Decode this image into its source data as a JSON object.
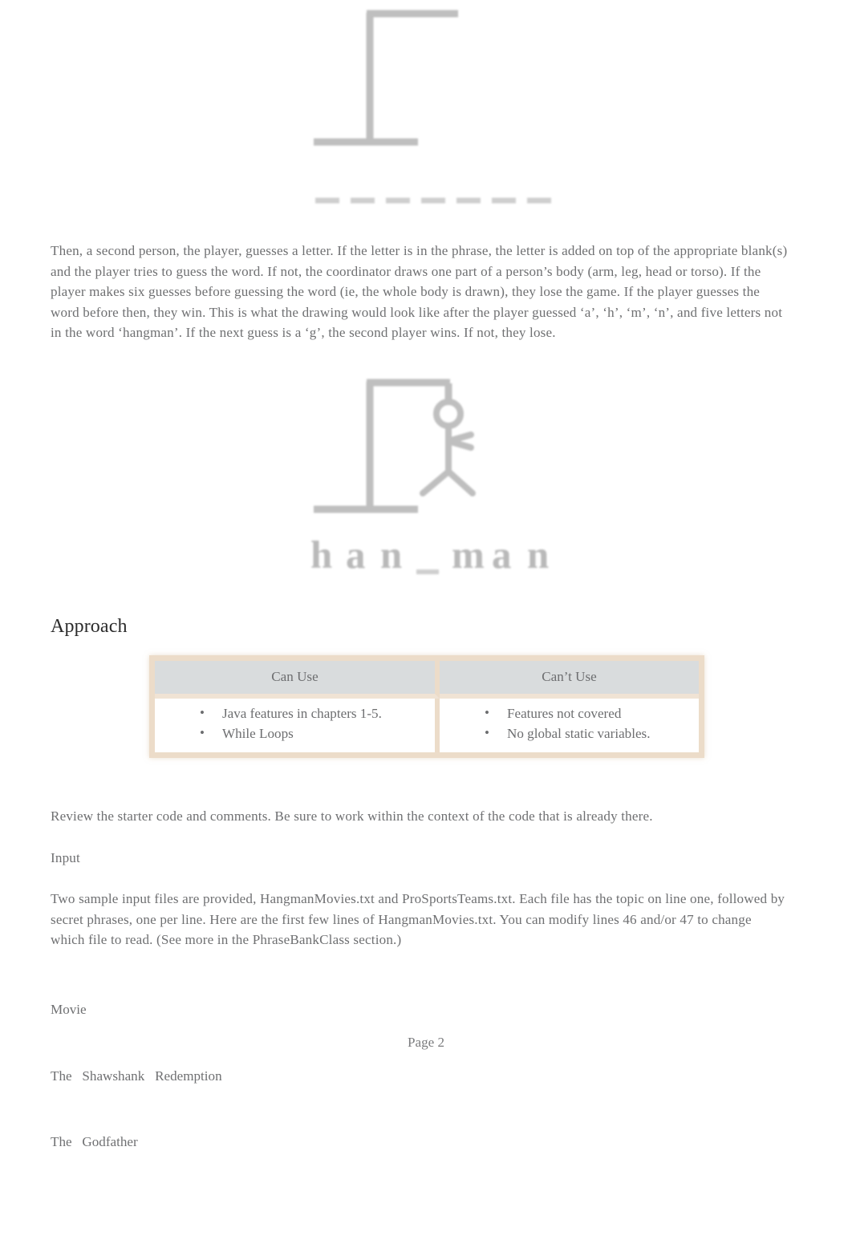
{
  "document": {
    "body_text_color": "#6f7072",
    "heading_color": "#2b2b2b",
    "table_border_color": "#ecdcc9",
    "table_header_bg": "#d9dcdd",
    "page_background": "#ffffff"
  },
  "figures": {
    "gallows_empty": {
      "caption_name": "hangman-gallows-empty",
      "blanks": "_ _ _ _ _ _ _",
      "blank_count": 7
    },
    "gallows_with_body": {
      "caption_name": "hangman-gallows-with-figure",
      "revealed": "h a n _ m a n",
      "blank_count": 7,
      "body_parts": [
        "head",
        "torso",
        "arm",
        "leg",
        "leg"
      ]
    }
  },
  "paragraphs": {
    "intro": "Then, a second person, the player, guesses a letter. If the letter is in the phrase, the letter is added on top of the appropriate blank(s) and the player tries to guess the word. If not, the coordinator draws one part of a person’s body (arm, leg, head or torso). If the player makes six guesses before guessing the word (ie, the whole body is drawn), they lose the game. If the player guesses the word before then, they win. This is what the drawing would look like after the player guessed ‘a’, ‘h’, ‘m’, ‘n’, and five letters not in the word ‘hangman’. If the next guess is a ‘g’, the second player wins. If not, they lose.",
    "review": "Review the starter code and comments. Be sure to work within the context of the code that is already there.",
    "input_label": "Input",
    "files": "Two sample input files are provided, HangmanMovies.txt and ProSportsTeams.txt. Each file has the topic on line one, followed by secret phrases, one per line. Here are the first few lines of HangmanMovies.txt. You can modify lines 46 and/or 47 to change which file to read. (See more in the PhraseBankClass section.)"
  },
  "headings": {
    "approach": "Approach"
  },
  "approach_table": {
    "columns": [
      {
        "header": "Can Use",
        "items": [
          "Java features in chapters 1-5.",
          "While Loops"
        ]
      },
      {
        "header": "Can’t Use",
        "items": [
          "Features not covered",
          "No global static variables."
        ]
      }
    ]
  },
  "sample_file_lines": {
    "line1": "Movie",
    "line2": "The   Shawshank   Redemption",
    "line3": "The   Godfather"
  },
  "footer": {
    "page_label": "Page 2"
  }
}
